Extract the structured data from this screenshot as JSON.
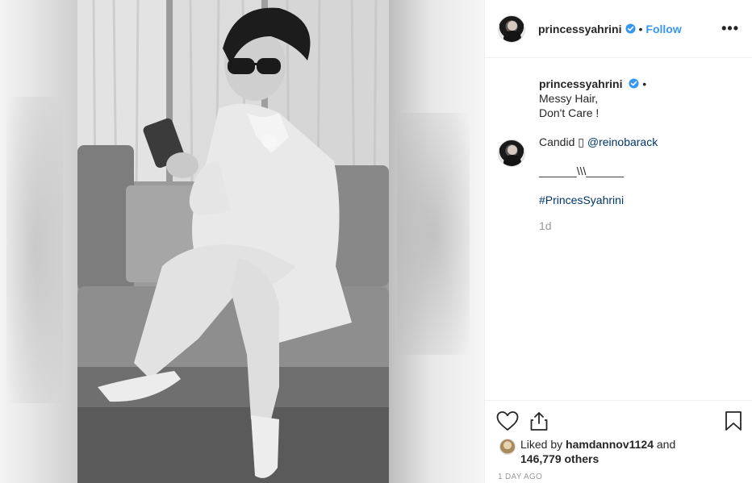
{
  "post": {
    "username": "princessyahrini",
    "follow_label": "Follow",
    "separator": "•",
    "more_label": "•••"
  },
  "caption": {
    "username": "princessyahrini",
    "separator": "•",
    "line1": "Messy Hair,",
    "line2": "Don't Care !",
    "candid_prefix": "Candid ▯ ",
    "mention": "@reinobarack",
    "divider": "______\\\\\\______",
    "hashtag": "#PrincesSyahrini",
    "time": "1d"
  },
  "likes": {
    "prefix": "Liked by ",
    "liker": "hamdannov1124",
    "middle": " and",
    "count": "146,779 others"
  },
  "timestamp": "1 DAY AGO",
  "icons": {
    "like": "heart-outline-icon",
    "share": "share-icon",
    "save": "bookmark-icon",
    "verified": "verified-badge-icon",
    "more": "more-options-icon"
  },
  "colors": {
    "link": "#3897f0",
    "mention": "#003569",
    "muted": "#999999",
    "text": "#262626",
    "border": "#efefef"
  }
}
